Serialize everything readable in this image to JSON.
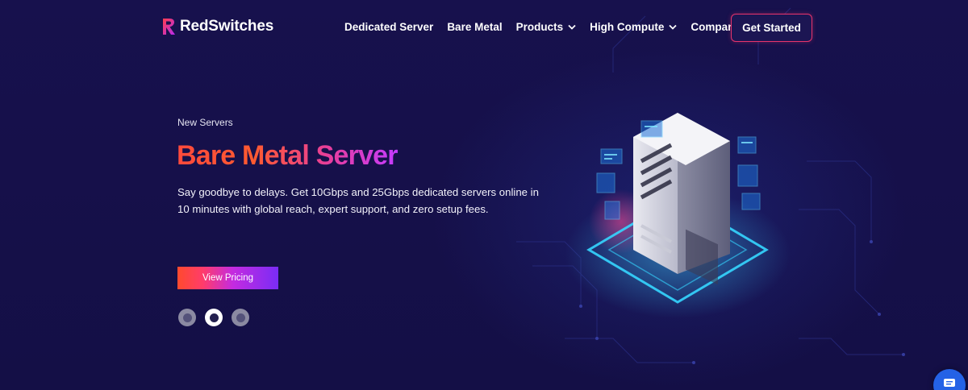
{
  "brand": {
    "name": "RedSwitches",
    "logo_icon": "redswitches-logo-icon"
  },
  "nav": {
    "items": [
      {
        "label": "Dedicated Server",
        "has_dropdown": false
      },
      {
        "label": "Bare Metal",
        "has_dropdown": false
      },
      {
        "label": "Products",
        "has_dropdown": true
      },
      {
        "label": "High Compute",
        "has_dropdown": true
      },
      {
        "label": "Company",
        "has_dropdown": true
      }
    ],
    "cta_label": "Get Started"
  },
  "hero": {
    "eyebrow": "New Servers",
    "title": "Bare Metal Server",
    "description": "Say goodbye to delays. Get 10Gbps and 25Gbps dedicated servers online in 10 minutes with global reach, expert support, and zero setup fees.",
    "button_label": "View Pricing",
    "slides_total": 3,
    "active_slide": 2
  },
  "chat": {
    "icon": "chat-icon"
  },
  "colors": {
    "background": "#15104a",
    "accent_red": "#ff4a3c",
    "accent_purple": "#c43bff",
    "cta_border": "#e8336b",
    "chat_blue": "#2462e6"
  }
}
